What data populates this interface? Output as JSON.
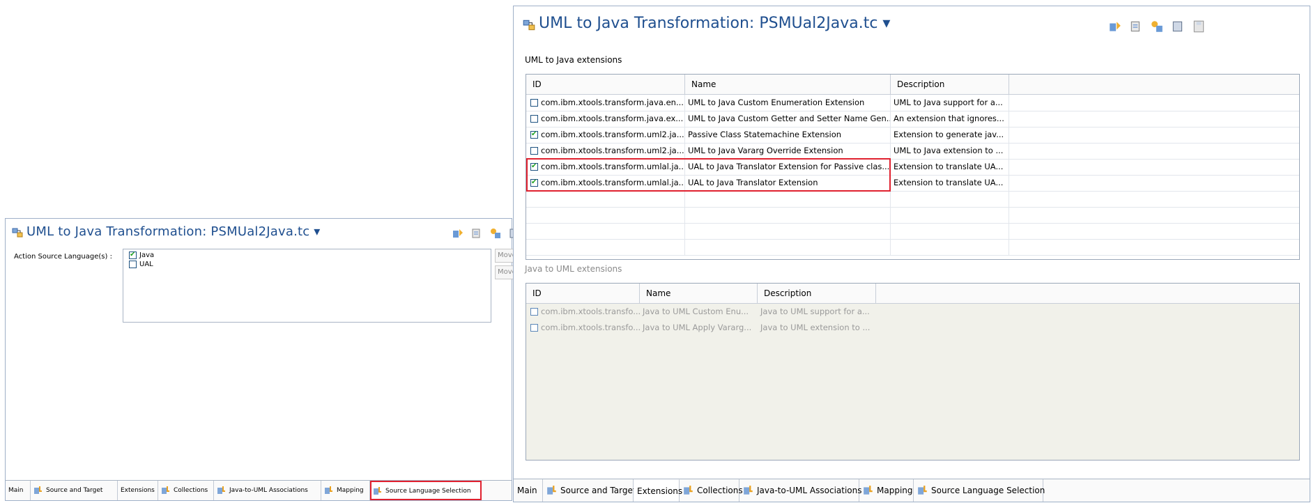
{
  "left_panel": {
    "title": "UML to Java Transformation: PSMUal2Java.tc ▾",
    "action_label": "Action Source Language(s) :",
    "languages": [
      {
        "label": "Java",
        "checked": true
      },
      {
        "label": "UAL",
        "checked": false
      }
    ],
    "side_buttons": [
      "Move",
      "Move"
    ],
    "tabs": [
      "Main",
      "Source and Target",
      "Extensions",
      "Collections",
      "Java-to-UML Associations",
      "Mapping",
      "Source Language Selection"
    ]
  },
  "right_panel": {
    "title": "UML to Java Transformation: PSMUal2Java.tc ▾",
    "uml_to_java_label": "UML to Java extensions",
    "uml_headers": [
      "ID",
      "Name",
      "Description"
    ],
    "uml_rows": [
      {
        "checked": false,
        "id": "com.ibm.xtools.transform.java.en...",
        "name": "UML to Java Custom Enumeration Extension",
        "desc": "UML to Java support for a..."
      },
      {
        "checked": false,
        "id": "com.ibm.xtools.transform.java.ex...",
        "name": "UML to Java Custom Getter and Setter Name Gen...",
        "desc": "An extension that ignores..."
      },
      {
        "checked": true,
        "id": "com.ibm.xtools.transform.uml2.ja...",
        "name": "Passive Class Statemachine Extension",
        "desc": "Extension to generate jav..."
      },
      {
        "checked": false,
        "id": "com.ibm.xtools.transform.uml2.ja...",
        "name": "UML to Java Vararg Override Extension",
        "desc": "UML to Java extension to ..."
      },
      {
        "checked": true,
        "id": "com.ibm.xtools.transform.umlal.ja...",
        "name": "UAL to Java Translator Extension for Passive clas...",
        "desc": "Extension to translate UA..."
      },
      {
        "checked": true,
        "id": "com.ibm.xtools.transform.umlal.ja...",
        "name": "UAL to Java Translator Extension",
        "desc": "Extension to translate UA..."
      }
    ],
    "java_to_uml_label": "Java to UML extensions",
    "java_headers": [
      "ID",
      "Name",
      "Description"
    ],
    "java_rows": [
      {
        "checked": false,
        "id": "com.ibm.xtools.transfo...",
        "name": "Java to UML Custom Enu...",
        "desc": "Java to UML support for a..."
      },
      {
        "checked": false,
        "id": "com.ibm.xtools.transfo...",
        "name": "Java to UML Apply Vararg...",
        "desc": "Java to UML extension to ..."
      }
    ],
    "tabs": [
      "Main",
      "Source and Target",
      "Extensions",
      "Collections",
      "Java-to-UML Associations",
      "Mapping",
      "Source Language Selection"
    ]
  },
  "colors": {
    "title": "#1f4f8f",
    "highlight": "#e0212f",
    "check": "#21a121",
    "border": "#9fb0c8"
  }
}
